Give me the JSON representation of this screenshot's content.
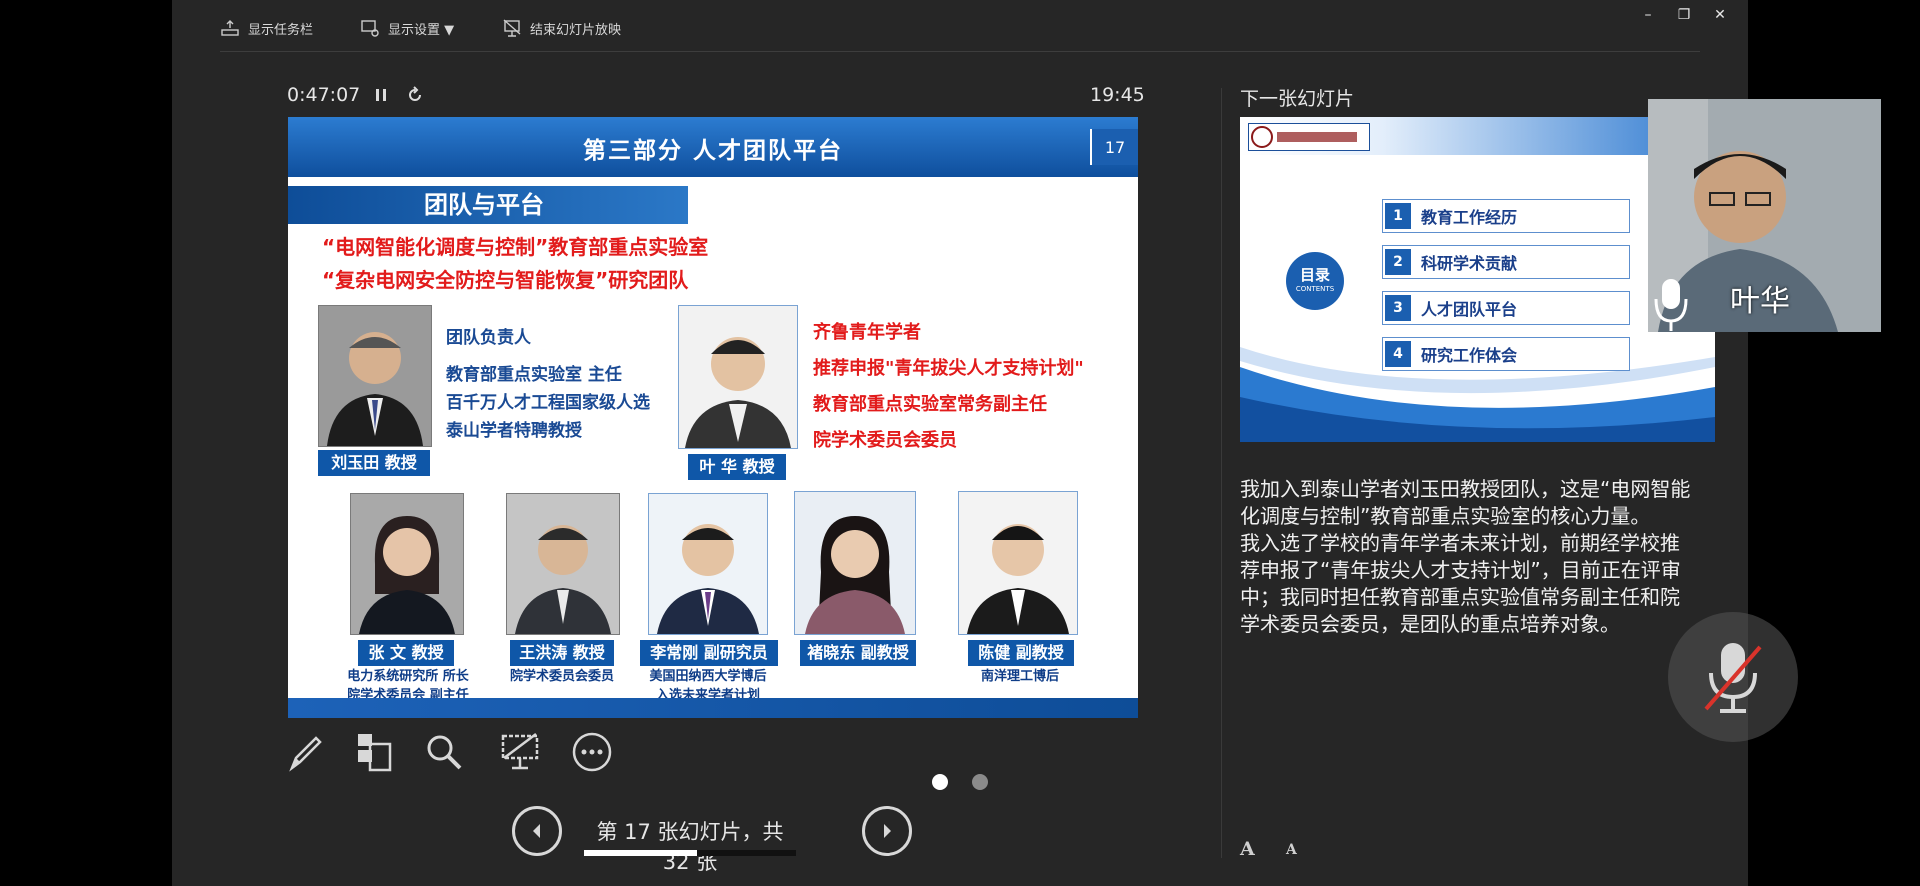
{
  "toolbar": {
    "show_taskbar": "显示任务栏",
    "display_settings": "显示设置 ▼",
    "end_slideshow": "结束幻灯片放映"
  },
  "window": {
    "minimize": "–",
    "restore": "❐",
    "close": "✕"
  },
  "timer": {
    "elapsed": "0:47:07",
    "clock": "19:45"
  },
  "slide": {
    "title": "第三部分  人才团队平台",
    "number": "17",
    "section": "团队与平台",
    "lab_line1": "“电网智能化调度与控制”教育部重点实验室",
    "lab_line2": "“复杂电网安全防控与智能恢复”研究团队",
    "leader": {
      "name": "刘玉田  教授",
      "role": "团队负责人",
      "lines": [
        "教育部重点实验室  主任",
        "百千万人才工程国家级人选",
        "泰山学者特聘教授"
      ]
    },
    "deputy": {
      "name": "叶  华 教授",
      "lines": [
        "齐鲁青年学者",
        "推荐申报\"青年拔尖人才支持计划\"",
        "教育部重点实验室常务副主任",
        "院学术委员会委员"
      ]
    },
    "members": [
      {
        "name": "张  文  教授",
        "caption1": "电力系统研究所 所长",
        "caption2": "院学术委员会 副主任"
      },
      {
        "name": "王洪涛 教授",
        "caption1": "院学术委员会委员",
        "caption2": ""
      },
      {
        "name": "李常刚 副研究员",
        "caption1": "美国田纳西大学博后",
        "caption2": "入选未来学者计划"
      },
      {
        "name": "褚晓东 副教授",
        "caption1": "",
        "caption2": ""
      },
      {
        "name": "陈健 副教授",
        "caption1": "南洋理工博后",
        "caption2": ""
      }
    ]
  },
  "pager": {
    "counter": "第 17 张幻灯片，共 32 张",
    "current": 17,
    "total": 32
  },
  "next": {
    "label": "下一张幻灯片",
    "toc_title": "目录",
    "toc_sub": "CONTENTS",
    "items": [
      {
        "num": "1",
        "label": "教育工作经历"
      },
      {
        "num": "2",
        "label": "科研学术贡献"
      },
      {
        "num": "3",
        "label": "人才团队平台"
      },
      {
        "num": "4",
        "label": "研究工作体会"
      }
    ]
  },
  "notes": "我加入到泰山学者刘玉田教授团队，这是“电网智能化调度与控制”教育部重点实验室的核心力量。\n我入选了学校的青年学者未来计划，前期经学校推荐申报了“青年拔尖人才支持计划”，目前正在评审中；我同时担任教育部重点实验值常务副主任和院学术委员会委员，是团队的重点培养对象。",
  "webcam": {
    "name": "叶华"
  },
  "font_controls": {
    "increase": "A",
    "decrease": "A"
  },
  "colors": {
    "slide_blue": "#0f57a8",
    "accent_red": "#e21b1b",
    "bg": "#262626"
  }
}
